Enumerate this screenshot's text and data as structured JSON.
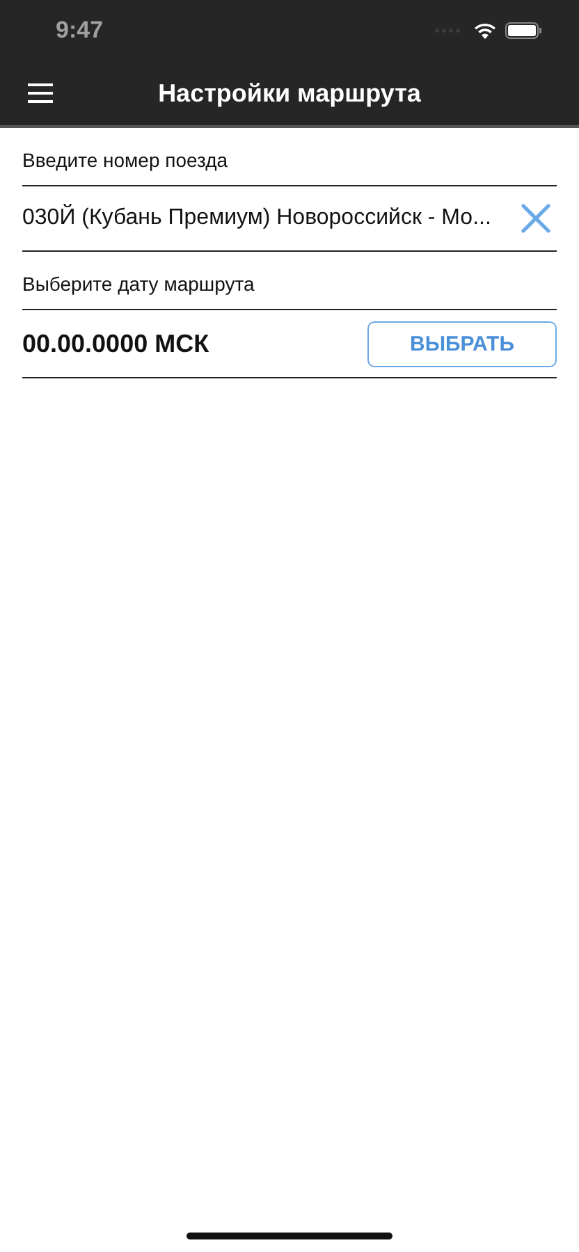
{
  "status_bar": {
    "time": "9:47"
  },
  "nav_bar": {
    "title": "Настройки маршрута"
  },
  "train": {
    "label": "Введите номер поезда",
    "value": "030Й (Кубань Премиум) Новороссийск - Мо..."
  },
  "date": {
    "label": "Выберите дату маршрута",
    "value": "00.00.0000 МСК",
    "button": "ВЫБРАТЬ"
  }
}
